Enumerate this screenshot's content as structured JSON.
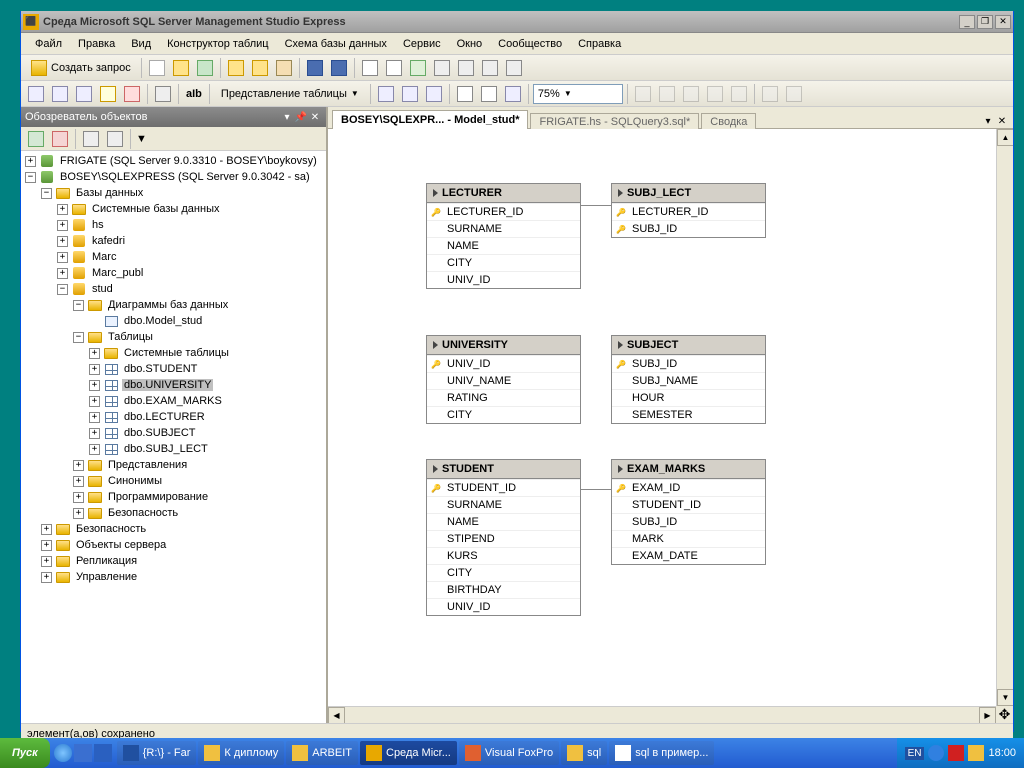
{
  "window": {
    "title": "Среда Microsoft SQL Server Management Studio Express"
  },
  "menu": [
    "Файл",
    "Правка",
    "Вид",
    "Конструктор таблиц",
    "Схема базы данных",
    "Сервис",
    "Окно",
    "Сообщество",
    "Справка"
  ],
  "toolbar1": {
    "new_query": "Создать запрос"
  },
  "toolbar2": {
    "view_mode": "Представление таблицы",
    "zoom": "75%"
  },
  "objexp": {
    "title": "Обозреватель объектов",
    "nodes": {
      "frigate": "FRIGATE (SQL Server 9.0.3310 - BOSEY\\boykovsy)",
      "bosey": "BOSEY\\SQLEXPRESS (SQL Server 9.0.3042 - sa)",
      "databases": "Базы данных",
      "sysdb": "Системные базы данных",
      "hs": "hs",
      "kafedri": "kafedri",
      "marc": "Marc",
      "marc_publ": "Marc_publ",
      "stud": "stud",
      "diagrams": "Диаграммы баз данных",
      "model_stud": "dbo.Model_stud",
      "tables": "Таблицы",
      "systables": "Системные таблицы",
      "t_student": "dbo.STUDENT",
      "t_university": "dbo.UNIVERSITY",
      "t_exam": "dbo.EXAM_MARKS",
      "t_lecturer": "dbo.LECTURER",
      "t_subject": "dbo.SUBJECT",
      "t_subj_lect": "dbo.SUBJ_LECT",
      "views": "Представления",
      "synonyms": "Синонимы",
      "programming": "Программирование",
      "security_db": "Безопасность",
      "security": "Безопасность",
      "server_obj": "Объекты сервера",
      "replication": "Репликация",
      "management": "Управление"
    }
  },
  "tabs": {
    "t1": "BOSEY\\SQLEXPR... - Model_stud*",
    "t2": "FRIGATE.hs - SQLQuery3.sql*",
    "t3": "Сводка"
  },
  "diagram": {
    "lecturer": {
      "name": "LECTURER",
      "cols": [
        "LECTURER_ID",
        "SURNAME",
        "NAME",
        "CITY",
        "UNIV_ID"
      ],
      "keys": [
        0
      ]
    },
    "subj_lect": {
      "name": "SUBJ_LECT",
      "cols": [
        "LECTURER_ID",
        "SUBJ_ID"
      ],
      "keys": [
        0,
        1
      ]
    },
    "university": {
      "name": "UNIVERSITY",
      "cols": [
        "UNIV_ID",
        "UNIV_NAME",
        "RATING",
        "CITY"
      ],
      "keys": [
        0
      ]
    },
    "subject": {
      "name": "SUBJECT",
      "cols": [
        "SUBJ_ID",
        "SUBJ_NAME",
        "HOUR",
        "SEMESTER"
      ],
      "keys": [
        0
      ]
    },
    "student": {
      "name": "STUDENT",
      "cols": [
        "STUDENT_ID",
        "SURNAME",
        "NAME",
        "STIPEND",
        "KURS",
        "CITY",
        "BIRTHDAY",
        "UNIV_ID"
      ],
      "keys": [
        0
      ]
    },
    "exam_marks": {
      "name": "EXAM_MARKS",
      "cols": [
        "EXAM_ID",
        "STUDENT_ID",
        "SUBJ_ID",
        "MARK",
        "EXAM_DATE"
      ],
      "keys": [
        0
      ]
    }
  },
  "statusbar": "элемент(а,ов) сохранено",
  "taskbar": {
    "start": "Пуск",
    "items": [
      "{R:\\} - Far",
      "К диплому",
      "ARBEIT",
      "Среда Micr...",
      "Visual FoxPro",
      "sql",
      "sql в пример..."
    ],
    "active_index": 3,
    "lang": "EN",
    "time": "18:00"
  }
}
